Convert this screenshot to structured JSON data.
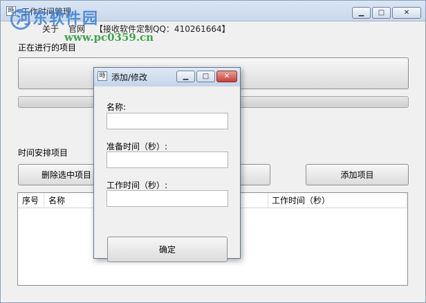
{
  "window": {
    "title": "工作时间管理",
    "app_icon_glyph": "時",
    "minimize_glyph": "▁",
    "maximize_glyph": "□",
    "close_glyph": "✕"
  },
  "watermark": {
    "text": "河东软件园",
    "url": "www.pc0359.cn"
  },
  "menu": {
    "items": [
      "关于",
      "官网",
      "【接收软件定制QQ：410261664】"
    ]
  },
  "current_section": {
    "label": "正在进行的项目"
  },
  "schedule_section": {
    "label": "时间安排项目",
    "delete_button": "删除选中项目",
    "add_button": "添加项目"
  },
  "list": {
    "columns": [
      "序号",
      "名称",
      "工作时间（秒）"
    ]
  },
  "dialog": {
    "title": "添加/修改",
    "icon_glyph": "時",
    "name_label": "名称:",
    "prep_label": "准备时间（秒）:",
    "work_label": "工作时间（秒）:",
    "name_value": "",
    "prep_value": "",
    "work_value": "",
    "ok_button": "确定",
    "minimize_glyph": "▁",
    "maximize_glyph": "□",
    "close_glyph": "✕"
  }
}
